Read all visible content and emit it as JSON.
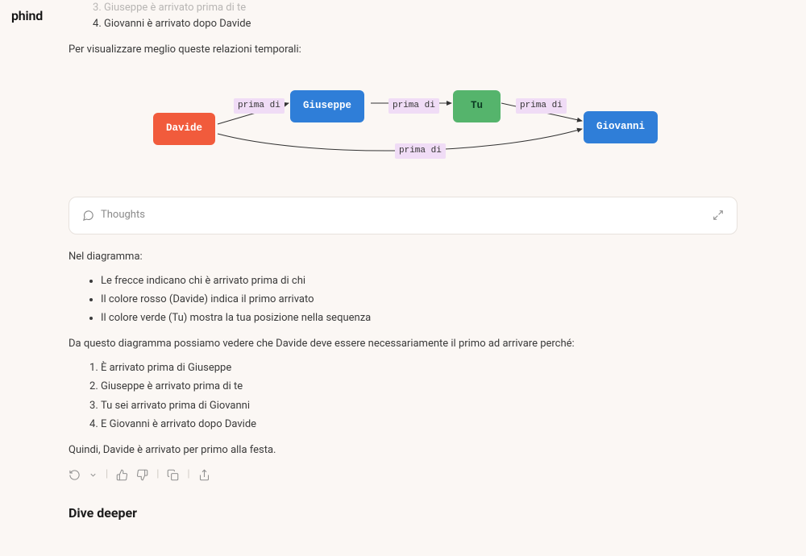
{
  "brand": "phind",
  "top_list": [
    {
      "n": 3,
      "text": "Giuseppe è arrivato prima di te",
      "faded": true
    },
    {
      "n": 4,
      "text": "Giovanni è arrivato dopo Davide",
      "faded": false
    }
  ],
  "intro_after_list": "Per visualizzare meglio queste relazioni temporali:",
  "diagram": {
    "nodes": {
      "davide": {
        "label": "Davide"
      },
      "giuseppe": {
        "label": "Giuseppe"
      },
      "tu": {
        "label": "Tu"
      },
      "giovanni": {
        "label": "Giovanni"
      }
    },
    "edge_label": "prima di"
  },
  "thoughts_label": "Thoughts",
  "after_diagram_heading": "Nel diagramma:",
  "bullets": [
    "Le frecce indicano chi è arrivato prima di chi",
    "Il colore rosso (Davide) indica il primo arrivato",
    "Il colore verde (Tu) mostra la tua posizione nella sequenza"
  ],
  "conclusion_intro": "Da questo diagramma possiamo vedere che Davide deve essere necessariamente il primo ad arrivare perché:",
  "reasons": [
    "È arrivato prima di Giuseppe",
    "Giuseppe è arrivato prima di te",
    "Tu sei arrivato prima di Giovanni",
    "E Giovanni è arrivato dopo Davide"
  ],
  "final": "Quindi, Davide è arrivato per primo alla festa.",
  "dive_deeper": "Dive deeper"
}
